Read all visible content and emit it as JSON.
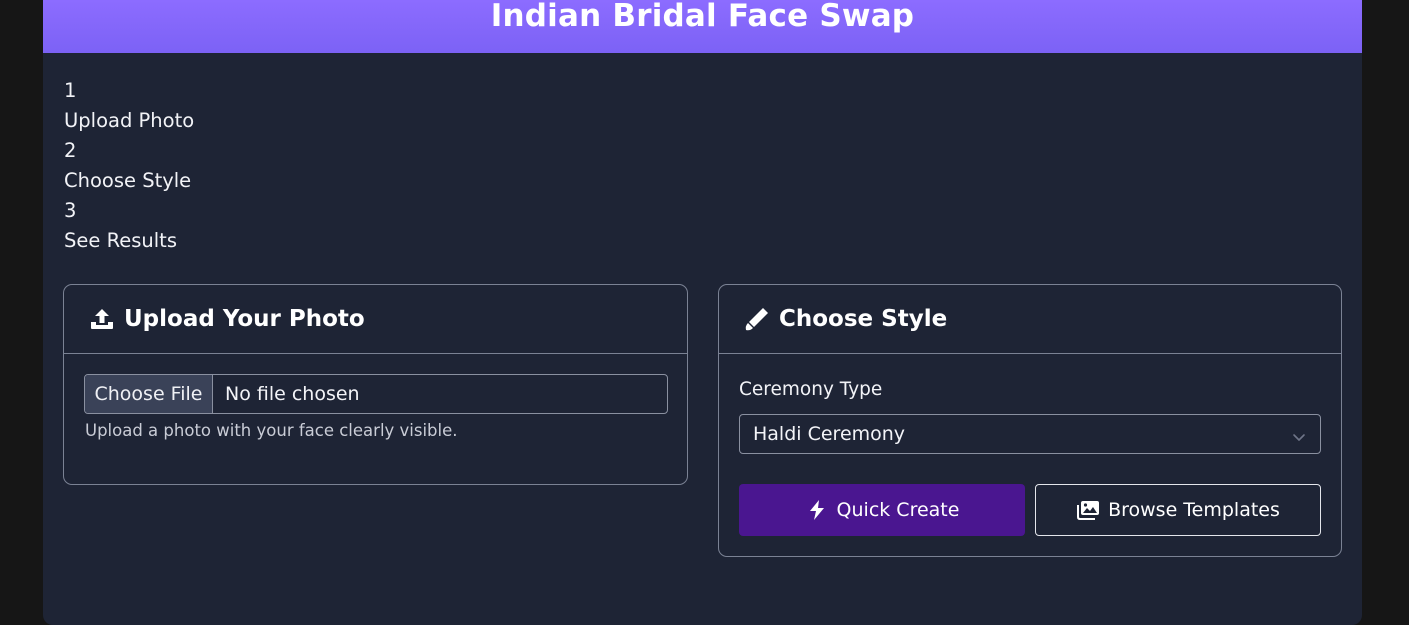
{
  "header": {
    "title": "Indian Bridal Face Swap"
  },
  "steps": [
    {
      "number": "1",
      "label": "Upload Photo"
    },
    {
      "number": "2",
      "label": "Choose Style"
    },
    {
      "number": "3",
      "label": "See Results"
    }
  ],
  "upload_card": {
    "title": "Upload Your Photo",
    "icon": "upload-icon",
    "file_button_label": "Choose File",
    "file_status": "No file chosen",
    "help_text": "Upload a photo with your face clearly visible."
  },
  "style_card": {
    "title": "Choose Style",
    "icon": "brush-icon",
    "ceremony_label": "Ceremony Type",
    "ceremony_selected": "Haldi Ceremony",
    "quick_create_label": "Quick Create",
    "quick_create_icon": "lightning-icon",
    "browse_templates_label": "Browse Templates",
    "browse_templates_icon": "images-icon"
  },
  "colors": {
    "header_gradient_top": "#8c6cff",
    "header_gradient_bottom": "#7c62f5",
    "background": "#1e2435",
    "primary_button": "#4a1690"
  }
}
